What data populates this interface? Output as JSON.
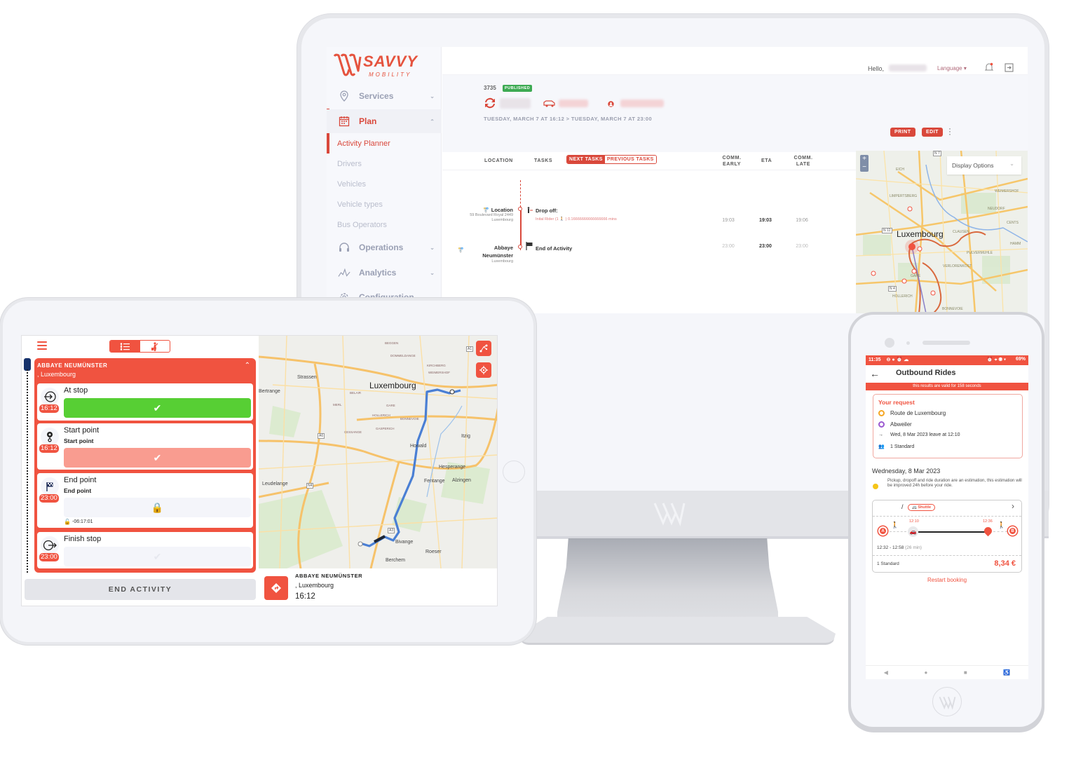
{
  "desktop": {
    "brand": {
      "name": "SAVVY",
      "tagline": "MOBILITY"
    },
    "sidebar": {
      "items": [
        {
          "label": "Services",
          "icon": "map-pin-icon",
          "expanded": false
        },
        {
          "label": "Plan",
          "icon": "calendar-icon",
          "expanded": true,
          "active": true
        },
        {
          "label": "Operations",
          "icon": "headset-icon",
          "expanded": false
        },
        {
          "label": "Analytics",
          "icon": "chart-line-icon",
          "expanded": false
        },
        {
          "label": "Configuration",
          "icon": "gear-icon",
          "expanded": false
        }
      ],
      "plan_subitems": [
        "Activity Planner",
        "Drivers",
        "Vehicles",
        "Vehicle types",
        "Bus Operators"
      ],
      "active_subitem": "Activity Planner"
    },
    "topbar": {
      "greeting": "Hello,",
      "language": "Language ▾"
    },
    "activity": {
      "id": "3735",
      "status": "PUBLISHED",
      "date_range": "TUESDAY, MARCH 7 AT 16:12 > TUESDAY, MARCH 7 AT 23:00",
      "print_label": "PRINT",
      "edit_label": "EDIT"
    },
    "table": {
      "headers": {
        "location": "LOCATION",
        "tasks": "TASKS",
        "comm_early": "COMM. EARLY",
        "eta": "ETA",
        "comm_late": "COMM. LATE"
      },
      "tabs": {
        "next": "NEXT TASKS",
        "previous": "PREVIOUS TASKS"
      },
      "rows": [
        {
          "location": "Location",
          "address": "59 Boulevard Royal 2449",
          "city": "Luxembourg",
          "task": "Drop off:",
          "detail": "Inital Rider (1 🚶 ) 0.16666666666666666 mins",
          "comm_early": "19:03",
          "eta": "19:03",
          "comm_late": "19:06"
        },
        {
          "location": "Abbaye Neumünster",
          "address": "",
          "city": "Luxembourg",
          "task": "End of Activity",
          "detail": "",
          "comm_early": "23:00",
          "eta": "23:00",
          "comm_late": "23:00"
        }
      ]
    },
    "map": {
      "display_options": "Display Options",
      "city_label": "Luxembourg",
      "zoom_in": "+",
      "zoom_out": "−",
      "places": [
        "EICH",
        "LIMPERTSBERG",
        "WEIMERSHOF",
        "NEUDORF",
        "CENTS",
        "CLAUSEN",
        "HAMM",
        "PULVERMUHLE",
        "VERLORENKOST",
        "GARE",
        "HOLLERICH",
        "BONNEVOIE",
        "N 12",
        "N 4",
        "N 7"
      ]
    }
  },
  "tablet": {
    "stop": {
      "name": "ABBAYE NEUMÜNSTER",
      "city": ", Luxembourg"
    },
    "cards": [
      {
        "title": "At stop",
        "subtitle": "",
        "time": "16:12",
        "state": "done",
        "icon": "arrive-icon"
      },
      {
        "title": "Start point",
        "subtitle": "Start point",
        "time": "16:12",
        "state": "pending",
        "icon": "start-pin-icon"
      },
      {
        "title": "End point",
        "subtitle": "End point",
        "time": "23:00",
        "state": "locked",
        "icon": "flag-icon",
        "countdown": "-06:17:01"
      },
      {
        "title": "Finish stop",
        "subtitle": "",
        "time": "23:00",
        "state": "disabled",
        "icon": "exit-icon"
      }
    ],
    "end_activity": "END ACTIVITY",
    "map": {
      "city_label": "Luxembourg",
      "places": [
        "Strassen",
        "Bertrange",
        "Howald",
        "Itzig",
        "Hesperange",
        "Leudelange",
        "Fentange",
        "Alzingen",
        "Bivange",
        "Roeser",
        "Berchem",
        "BEGGEN",
        "DOMMELDANGE",
        "KIRCHBERG",
        "WEIMERSHOF",
        "BELAIR",
        "MERL",
        "GARE",
        "HOLLERICH",
        "BONNEVOIE",
        "CESSANGE",
        "GASPERICH",
        "A6",
        "A1",
        "A3",
        "N4"
      ]
    },
    "next_stop": {
      "name": "ABBAYE NEUMÜNSTER",
      "city": ", Luxembourg",
      "time": "16:12"
    }
  },
  "phone": {
    "status_bar": {
      "time": "11:35",
      "battery": "69%"
    },
    "title": "Outbound Rides",
    "validity": "this results are valid for  158 seconds",
    "request": {
      "heading": "Your request",
      "from": "Route de Luxembourg",
      "to": "Abweiler",
      "when": "Wed, 8 Mar 2023  leave at  12:10",
      "passengers": "1 Standard"
    },
    "day": "Wednesday, 8 Mar 2023",
    "note": "Pickup, dropoff and ride duration are an estimation, this estimation will be improved 24h before your ride.",
    "ride": {
      "separator": "/",
      "mode": "Shuttle",
      "pickup_time": "12:10",
      "dropoff_time": "12:36",
      "range": "12:32 - 12:58",
      "duration": "(26 min)",
      "passengers": "1 Standard",
      "price": "8,34 €",
      "point_a": "A",
      "point_b": "B"
    },
    "restart": "Restart booking"
  },
  "colors": {
    "brand_red": "#e5533e",
    "tablet_red": "#f05340",
    "success_green": "#57cf34",
    "published_green": "#3daa53",
    "route_blue": "#4a7fd4"
  }
}
